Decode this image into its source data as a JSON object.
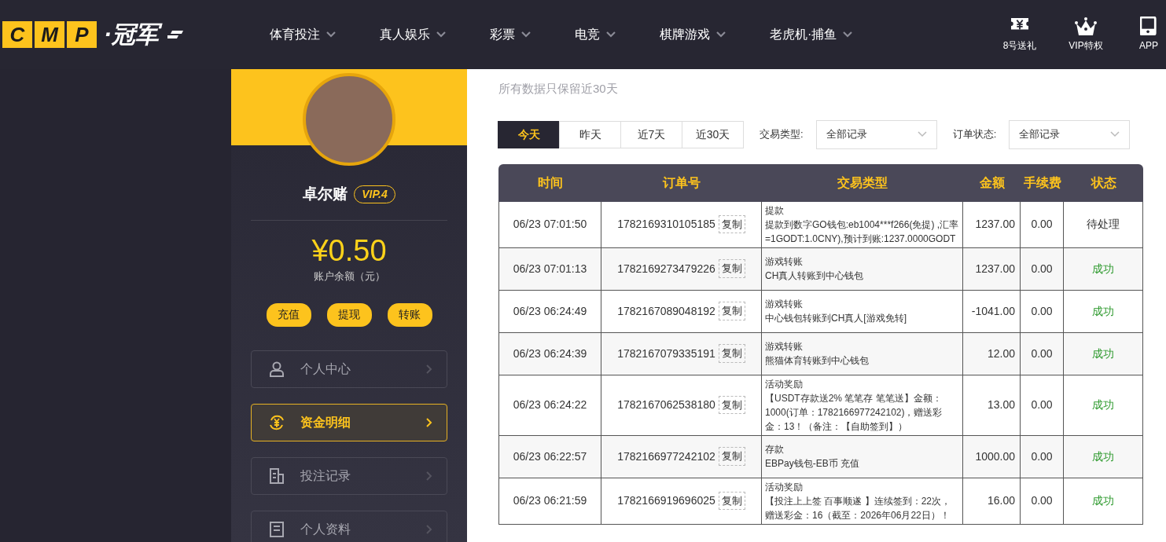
{
  "header": {
    "logo": {
      "letters": [
        "C",
        "M",
        "P"
      ],
      "text": "·冠军"
    },
    "nav": [
      {
        "label": "体育投注"
      },
      {
        "label": "真人娱乐"
      },
      {
        "label": "彩票"
      },
      {
        "label": "电竞"
      },
      {
        "label": "棋牌游戏"
      },
      {
        "label": "老虎机·捕鱼"
      }
    ],
    "actions": [
      {
        "kind": "ticket",
        "label": "8号送礼"
      },
      {
        "kind": "crown",
        "label": "VIP特权"
      },
      {
        "kind": "tablet",
        "label": "APP"
      }
    ]
  },
  "sidebar": {
    "username": "卓尔赌",
    "vip": "VIP.4",
    "balance": "¥0.50",
    "balance_label": "账户余额（元）",
    "wallet_buttons": [
      "充值",
      "提现",
      "转账"
    ],
    "menu": [
      {
        "kind": "user",
        "label": "个人中心",
        "selected": false
      },
      {
        "kind": "money",
        "label": "资金明细",
        "selected": true
      },
      {
        "kind": "bets",
        "label": "投注记录",
        "selected": false
      },
      {
        "kind": "profile",
        "label": "个人资料",
        "selected": false
      }
    ]
  },
  "main": {
    "subtitle": "所有数据只保留近30天",
    "ranges": [
      {
        "label": "今天",
        "selected": true
      },
      {
        "label": "昨天",
        "selected": false
      },
      {
        "label": "近7天",
        "selected": false
      },
      {
        "label": "近30天",
        "selected": false
      }
    ],
    "filters": [
      {
        "label": "交易类型:",
        "value": "全部记录"
      },
      {
        "label": "订单状态:",
        "value": "全部记录"
      }
    ],
    "table": {
      "columns": [
        "时间",
        "订单号",
        "交易类型",
        "金额",
        "手续费",
        "状态"
      ],
      "rows": [
        {
          "time": "06/23 07:01:50",
          "order": "1782169310105185",
          "copy": "复制",
          "type": "提款",
          "detail": "提款到数字GO钱包:eb1004***f266(免提) ,汇率=1GODT:1.0CNY),预计到账:1237.0000GODT",
          "amount": "1237.00",
          "fee": "0.00",
          "status": "待处理",
          "kind": "pending"
        },
        {
          "time": "06/23 07:01:13",
          "order": "1782169273479226",
          "copy": "复制",
          "type": "游戏转账",
          "detail": "CH真人转账到中心钱包",
          "amount": "1237.00",
          "fee": "0.00",
          "status": "成功",
          "kind": "success"
        },
        {
          "time": "06/23 06:24:49",
          "order": "1782167089048192",
          "copy": "复制",
          "type": "游戏转账",
          "detail": "中心钱包转账到CH真人[游戏免转]",
          "amount": "-1041.00",
          "fee": "0.00",
          "status": "成功",
          "kind": "success"
        },
        {
          "time": "06/23 06:24:39",
          "order": "1782167079335191",
          "copy": "复制",
          "type": "游戏转账",
          "detail": "熊猫体育转账到中心钱包",
          "amount": "12.00",
          "fee": "0.00",
          "status": "成功",
          "kind": "success"
        },
        {
          "time": "06/23 06:24:22",
          "order": "1782167062538180",
          "copy": "复制",
          "type": "活动奖励",
          "detail": "【USDT存款送2% 笔笔存 笔笔送】金额：1000(订单：1782166977242102)，赠送彩金：13！（备注：【自助签到】）",
          "amount": "13.00",
          "fee": "0.00",
          "status": "成功",
          "kind": "success"
        },
        {
          "time": "06/23 06:22:57",
          "order": "1782166977242102",
          "copy": "复制",
          "type": "存款",
          "detail": "EBPay钱包-EB币 充值",
          "amount": "1000.00",
          "fee": "0.00",
          "status": "成功",
          "kind": "success"
        },
        {
          "time": "06/23 06:21:59",
          "order": "1782166919696025",
          "copy": "复制",
          "type": "活动奖励",
          "detail": "【投注上上签 百事顺遂 】连续签到：22次，赠送彩金：16（截至：2026年06月22日）！",
          "amount": "16.00",
          "fee": "0.00",
          "status": "成功",
          "kind": "success"
        }
      ]
    }
  }
}
